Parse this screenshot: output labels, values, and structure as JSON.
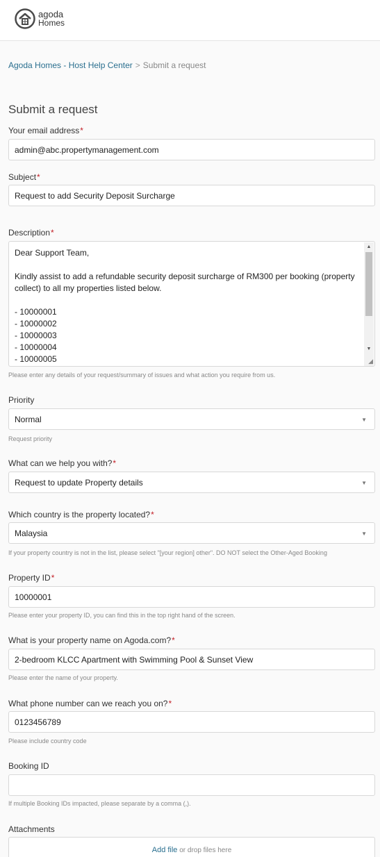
{
  "header": {
    "logo_line1": "agoda",
    "logo_line2": "Homes"
  },
  "breadcrumb": {
    "home": "Agoda Homes - Host Help Center",
    "separator": ">",
    "current": "Submit a request"
  },
  "page_title": "Submit a request",
  "form": {
    "email": {
      "label": "Your email address",
      "value": "admin@abc.propertymanagement.com"
    },
    "subject": {
      "label": "Subject",
      "value": "Request to add Security Deposit Surcharge"
    },
    "description": {
      "label": "Description",
      "value": "Dear Support Team,\n\nKindly assist to add a refundable security deposit surcharge of RM300 per booking (property collect) to all my properties listed below.\n\n- 10000001\n- 10000002\n- 10000003\n- 10000004\n- 10000005",
      "hint": "Please enter any details of your request/summary of issues and what action you require from us."
    },
    "priority": {
      "label": "Priority",
      "value": "Normal",
      "hint": "Request priority"
    },
    "help_with": {
      "label": "What can we help you with?",
      "value": "Request to update Property details"
    },
    "country": {
      "label": "Which country is the property located?",
      "value": "Malaysia",
      "hint": "If your property country is not in the list, please select \"[your region] other\". DO NOT select the Other-Aged Booking"
    },
    "property_id": {
      "label": "Property ID",
      "value": "10000001",
      "hint": "Please enter your property ID, you can find this in the top right hand of the screen."
    },
    "property_name": {
      "label": "What is your property name on Agoda.com?",
      "value": "2-bedroom KLCC Apartment with Swimming Pool & Sunset View",
      "hint": "Please enter the name of your property."
    },
    "phone": {
      "label": "What phone number can we reach you on?",
      "value": "0123456789",
      "hint": "Please include country code"
    },
    "booking_id": {
      "label": "Booking ID",
      "value": "",
      "hint": "If multiple Booking IDs impacted, please separate by a comma (,)."
    },
    "attachments": {
      "label": "Attachments",
      "add_file": "Add file",
      "drop_text": "or drop files here"
    }
  },
  "colors": {
    "link": "#2a6f8f",
    "required": "#c21e25"
  },
  "icons": {
    "select": "chevron-down-icon",
    "logo": "house-icon"
  }
}
